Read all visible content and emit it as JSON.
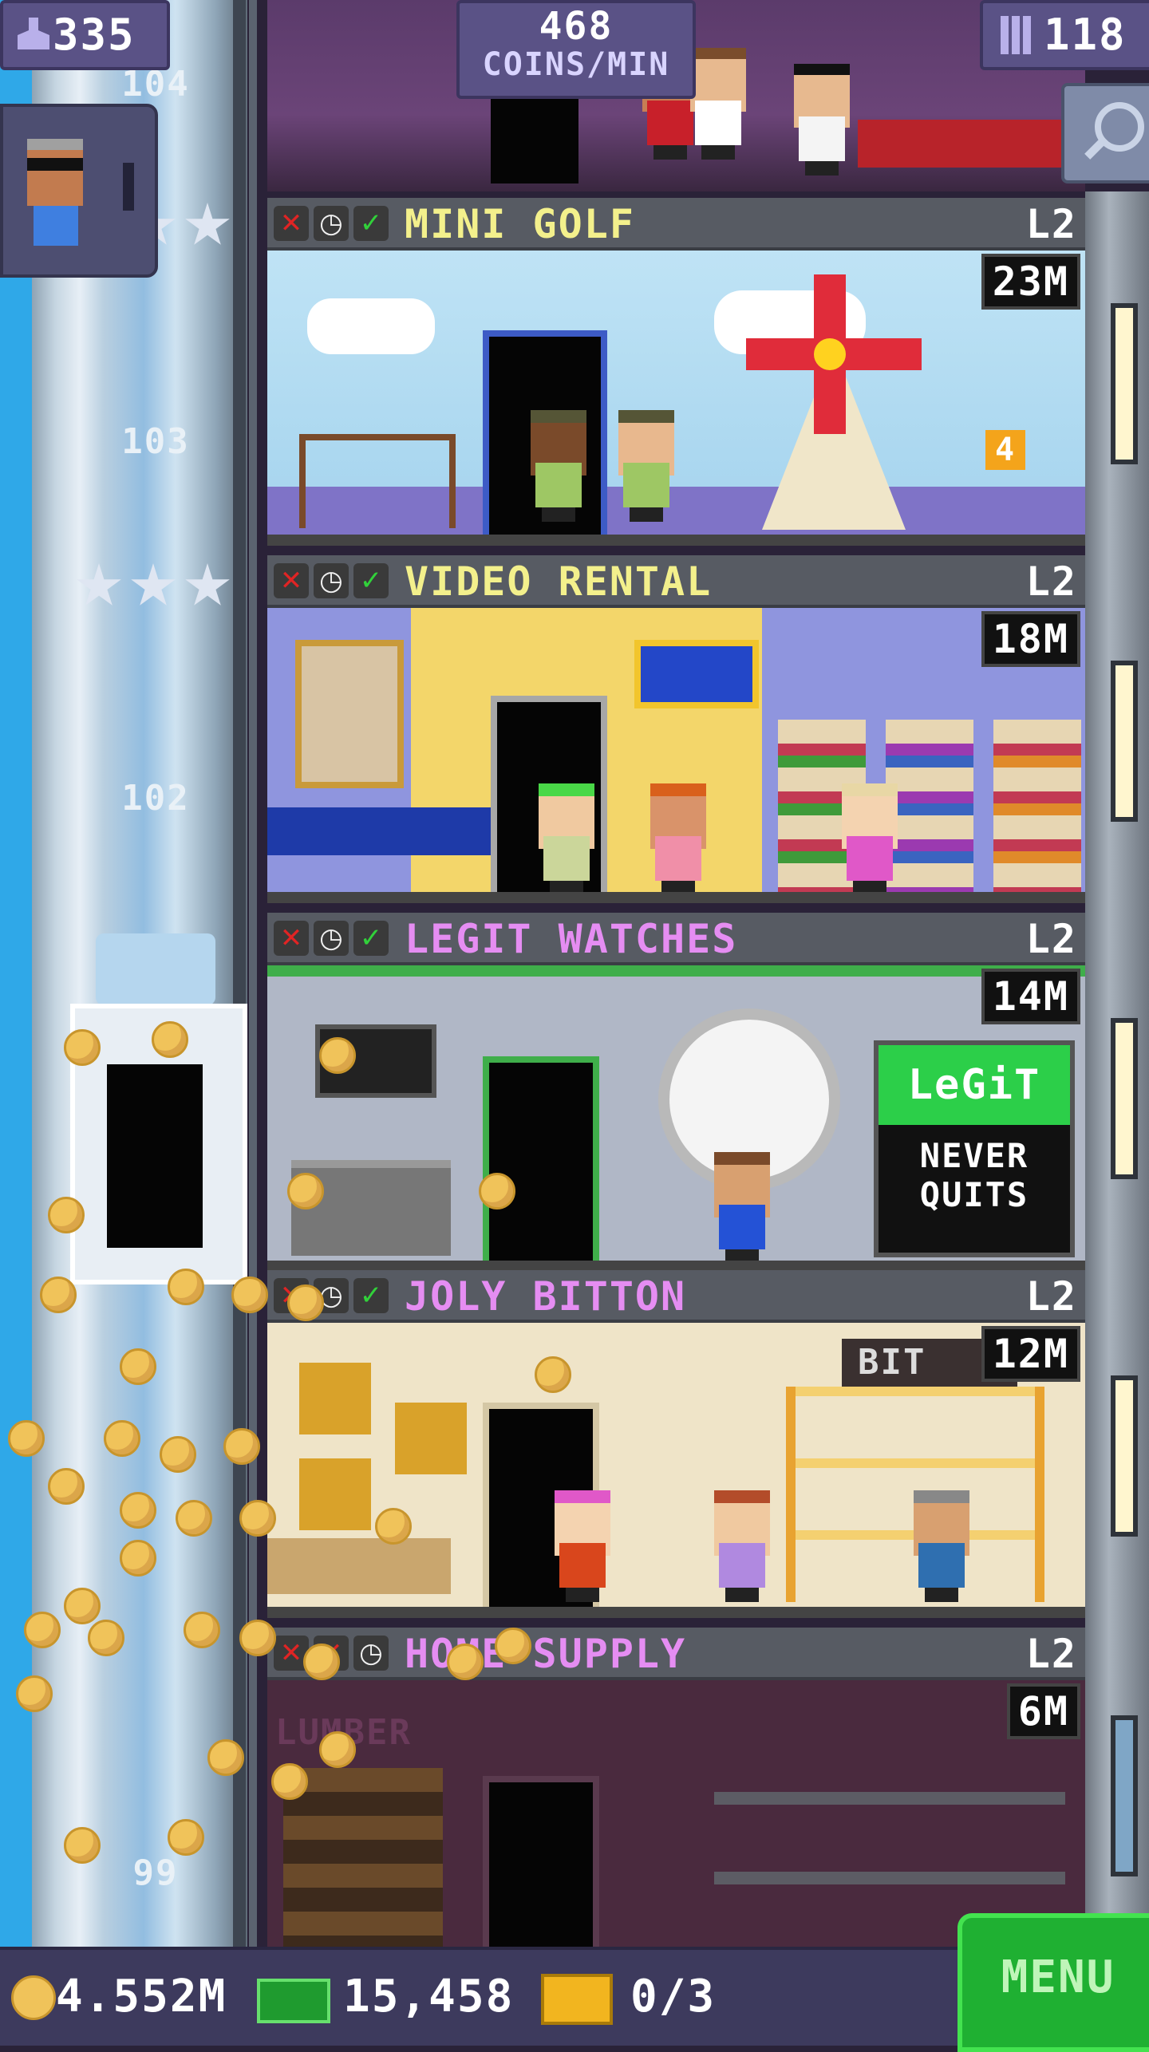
{
  "hud": {
    "population": "335",
    "coins_per_min_value": "468",
    "coins_per_min_unit": "COINS/MIN",
    "floor_count": "118"
  },
  "shaft": {
    "floor_labels": [
      "104",
      "103",
      "102",
      "99"
    ]
  },
  "floors": [
    {
      "name": "MINI GOLF",
      "level": "L2",
      "income": "23M",
      "name_color": "#f3f08c",
      "sign": "4"
    },
    {
      "name": "VIDEO RENTAL",
      "level": "L2",
      "income": "18M",
      "name_color": "#f3f08c"
    },
    {
      "name": "LEGIT WATCHES",
      "level": "L2",
      "income": "14M",
      "name_color": "#e58df2",
      "sign_top": "LeGiT",
      "sign_bottom_1": "NEVER",
      "sign_bottom_2": "QUITS"
    },
    {
      "name": "JOLY BITTON",
      "level": "L2",
      "income": "12M",
      "name_color": "#e58df2",
      "sign": "BIT"
    },
    {
      "name": "HOME SUPPLY",
      "level": "L2",
      "income": "6M",
      "name_color": "#e58df2",
      "sign": "LUMBER"
    }
  ],
  "bottom": {
    "coins": "4.552M",
    "bux": "15,458",
    "chests": "0/3",
    "menu_label": "MENU"
  },
  "colors": {
    "hud_panel": "#5a5286",
    "menu_green": "#1fb032",
    "coin_gold": "#f0c35a"
  },
  "icons": [
    "person-icon",
    "building-icon",
    "search-icon",
    "coin-icon",
    "bux-icon",
    "chest-icon",
    "x-icon",
    "clock-icon",
    "check-icon",
    "star-icon"
  ]
}
